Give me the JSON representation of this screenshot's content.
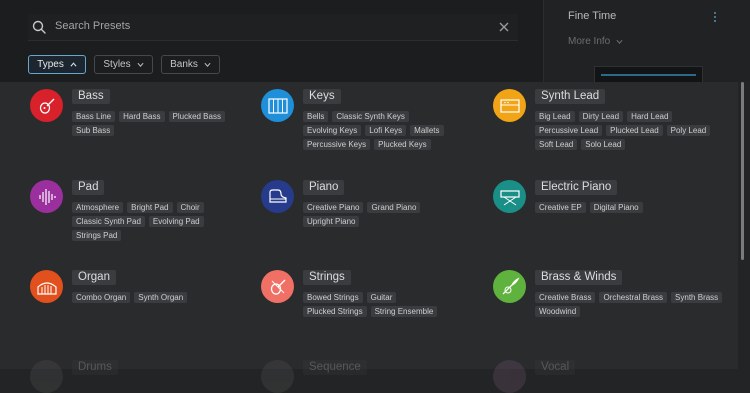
{
  "search": {
    "placeholder": "Search Presets"
  },
  "filters": [
    {
      "label": "Types",
      "active": true
    },
    {
      "label": "Styles",
      "active": false
    },
    {
      "label": "Banks",
      "active": false
    }
  ],
  "right_panel": {
    "title": "Fine Time",
    "more_info": "More Info"
  },
  "categories": [
    {
      "name": "Bass",
      "color": "#d8212a",
      "icon": "bass-guitar-icon",
      "tags": [
        "Bass Line",
        "Hard Bass",
        "Plucked Bass",
        "Sub Bass"
      ]
    },
    {
      "name": "Keys",
      "color": "#1e8fd8",
      "icon": "keyboard-icon",
      "tags": [
        "Bells",
        "Classic Synth Keys",
        "Evolving Keys",
        "Lofi Keys",
        "Mallets",
        "Percussive Keys",
        "Plucked Keys"
      ]
    },
    {
      "name": "Synth Lead",
      "color": "#f0a416",
      "icon": "synth-icon",
      "tags": [
        "Big Lead",
        "Dirty Lead",
        "Hard Lead",
        "Percussive Lead",
        "Plucked Lead",
        "Poly Lead",
        "Soft Lead",
        "Solo Lead"
      ]
    },
    {
      "name": "Pad",
      "color": "#9b2f9e",
      "icon": "waveform-icon",
      "tags": [
        "Atmosphere",
        "Bright Pad",
        "Choir",
        "Classic Synth Pad",
        "Evolving Pad",
        "Strings Pad"
      ]
    },
    {
      "name": "Piano",
      "color": "#263b8c",
      "icon": "grand-piano-icon",
      "tags": [
        "Creative Piano",
        "Grand Piano",
        "Upright Piano"
      ]
    },
    {
      "name": "Electric Piano",
      "color": "#1a8f88",
      "icon": "electric-piano-icon",
      "tags": [
        "Creative EP",
        "Digital Piano"
      ]
    },
    {
      "name": "Organ",
      "color": "#e2511d",
      "icon": "organ-icon",
      "tags": [
        "Combo Organ",
        "Synth Organ"
      ]
    },
    {
      "name": "Strings",
      "color": "#f07066",
      "icon": "violin-icon",
      "tags": [
        "Bowed Strings",
        "Guitar",
        "Plucked Strings",
        "String Ensemble"
      ]
    },
    {
      "name": "Brass & Winds",
      "color": "#5fb23e",
      "icon": "trumpet-icon",
      "tags": [
        "Creative Brass",
        "Orchestral Brass",
        "Synth Brass",
        "Woodwind"
      ]
    },
    {
      "name": "Drums",
      "color": "#3a3a3c",
      "icon": "drum-icon",
      "tags": []
    },
    {
      "name": "Sequence",
      "color": "#3a3a3c",
      "icon": "sequence-icon",
      "tags": []
    },
    {
      "name": "Vocal",
      "color": "#4a3a4a",
      "icon": "vocal-icon",
      "tags": []
    }
  ]
}
